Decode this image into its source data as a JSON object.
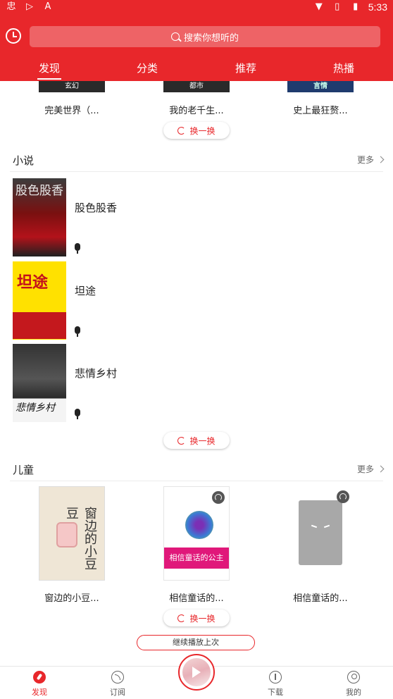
{
  "status_bar": {
    "time": "5:33"
  },
  "search": {
    "placeholder": "搜索你想听的"
  },
  "tabs": [
    {
      "label": "发现",
      "active": true
    },
    {
      "label": "分类",
      "active": false
    },
    {
      "label": "推荐",
      "active": false
    },
    {
      "label": "热播",
      "active": false
    }
  ],
  "top_books": [
    {
      "tag": "玄幻",
      "title": "完美世界（..."
    },
    {
      "tag": "都市",
      "title": "我的老千生..."
    },
    {
      "tag": "言情",
      "title": "史上最狂赘..."
    }
  ],
  "swap_label": "换一换",
  "novel": {
    "title": "小说",
    "more": "更多",
    "items": [
      {
        "title": "股色股香",
        "cover_text": "股色股香"
      },
      {
        "title": "坦途",
        "cover_text": "坦途"
      },
      {
        "title": "悲情乡村",
        "cover_text": "悲情乡村"
      }
    ]
  },
  "kids": {
    "title": "儿童",
    "more": "更多",
    "items": [
      {
        "title": "窗边的小豆...",
        "cover_text": "窗边的小豆豆"
      },
      {
        "title": "相信童话的...",
        "cover_text": "相信童话的公主"
      },
      {
        "title": "相信童话的..."
      }
    ]
  },
  "continue_label": "继续播放上次",
  "bottom_nav": [
    {
      "label": "发现",
      "icon": "compass-icon",
      "active": true
    },
    {
      "label": "订阅",
      "icon": "rss-icon",
      "active": false
    },
    {
      "label": "下载",
      "icon": "download-icon",
      "active": false
    },
    {
      "label": "我的",
      "icon": "user-icon",
      "active": false
    }
  ],
  "colors": {
    "accent": "#e8272b"
  }
}
